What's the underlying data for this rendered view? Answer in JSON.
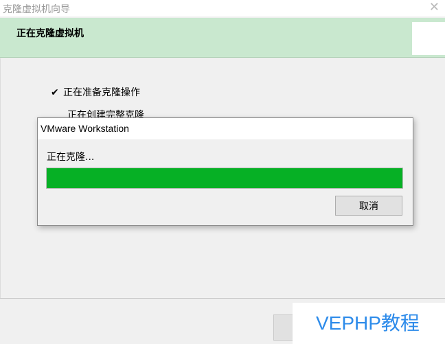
{
  "window": {
    "title": "克隆虚拟机向导",
    "close_glyph": "✕"
  },
  "header": {
    "heading": "正在克隆虚拟机"
  },
  "steps": [
    {
      "label": "正在准备克隆操作",
      "done": true
    },
    {
      "label": "正在创建完整克隆",
      "done": false
    }
  ],
  "check_glyph": "✔",
  "dialog": {
    "title": "VMware Workstation",
    "status": "正在克隆...",
    "progress_fraction": 1.0,
    "progress_color": "#06b025",
    "cancel_label": "取消"
  },
  "watermark": {
    "text": "VEPHP教程",
    "color": "#2d8bea"
  }
}
